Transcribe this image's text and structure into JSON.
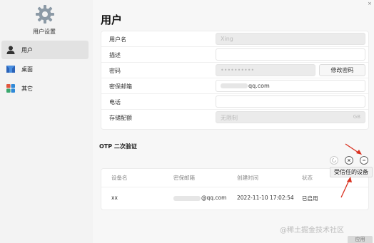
{
  "sidebar": {
    "app_title": "用户设置",
    "items": [
      {
        "label": "用户",
        "icon": "user-icon",
        "active": true
      },
      {
        "label": "桌面",
        "icon": "desktop-icon",
        "active": false
      },
      {
        "label": "其它",
        "icon": "apps-icon",
        "active": false
      }
    ]
  },
  "main": {
    "title": "用户",
    "form": {
      "username": {
        "label": "用户名",
        "value": "Xing"
      },
      "description": {
        "label": "描述",
        "value": ""
      },
      "password": {
        "label": "密码",
        "value": "••••••••••",
        "button": "修改密码"
      },
      "email": {
        "label": "密保邮箱",
        "value": "qq.com"
      },
      "phone": {
        "label": "电话",
        "value": ""
      },
      "storage": {
        "label": "存储配额",
        "value": "无限制",
        "unit": "GB"
      }
    },
    "otp": {
      "title": "OTP 二次验证",
      "table": {
        "headers": [
          "设备名",
          "密保邮箱",
          "创建时间",
          "状态"
        ],
        "rows": [
          {
            "device": "xx",
            "email": "@qq.com",
            "created": "2022-11-10 17:02:54",
            "status": "已启用"
          }
        ]
      },
      "tooltip": "受信任的设备"
    }
  },
  "watermark": "@稀土掘金技术社区",
  "footer_button": "应用",
  "close_label": "×",
  "colors": {
    "accent_arrow": "#d9301f"
  }
}
